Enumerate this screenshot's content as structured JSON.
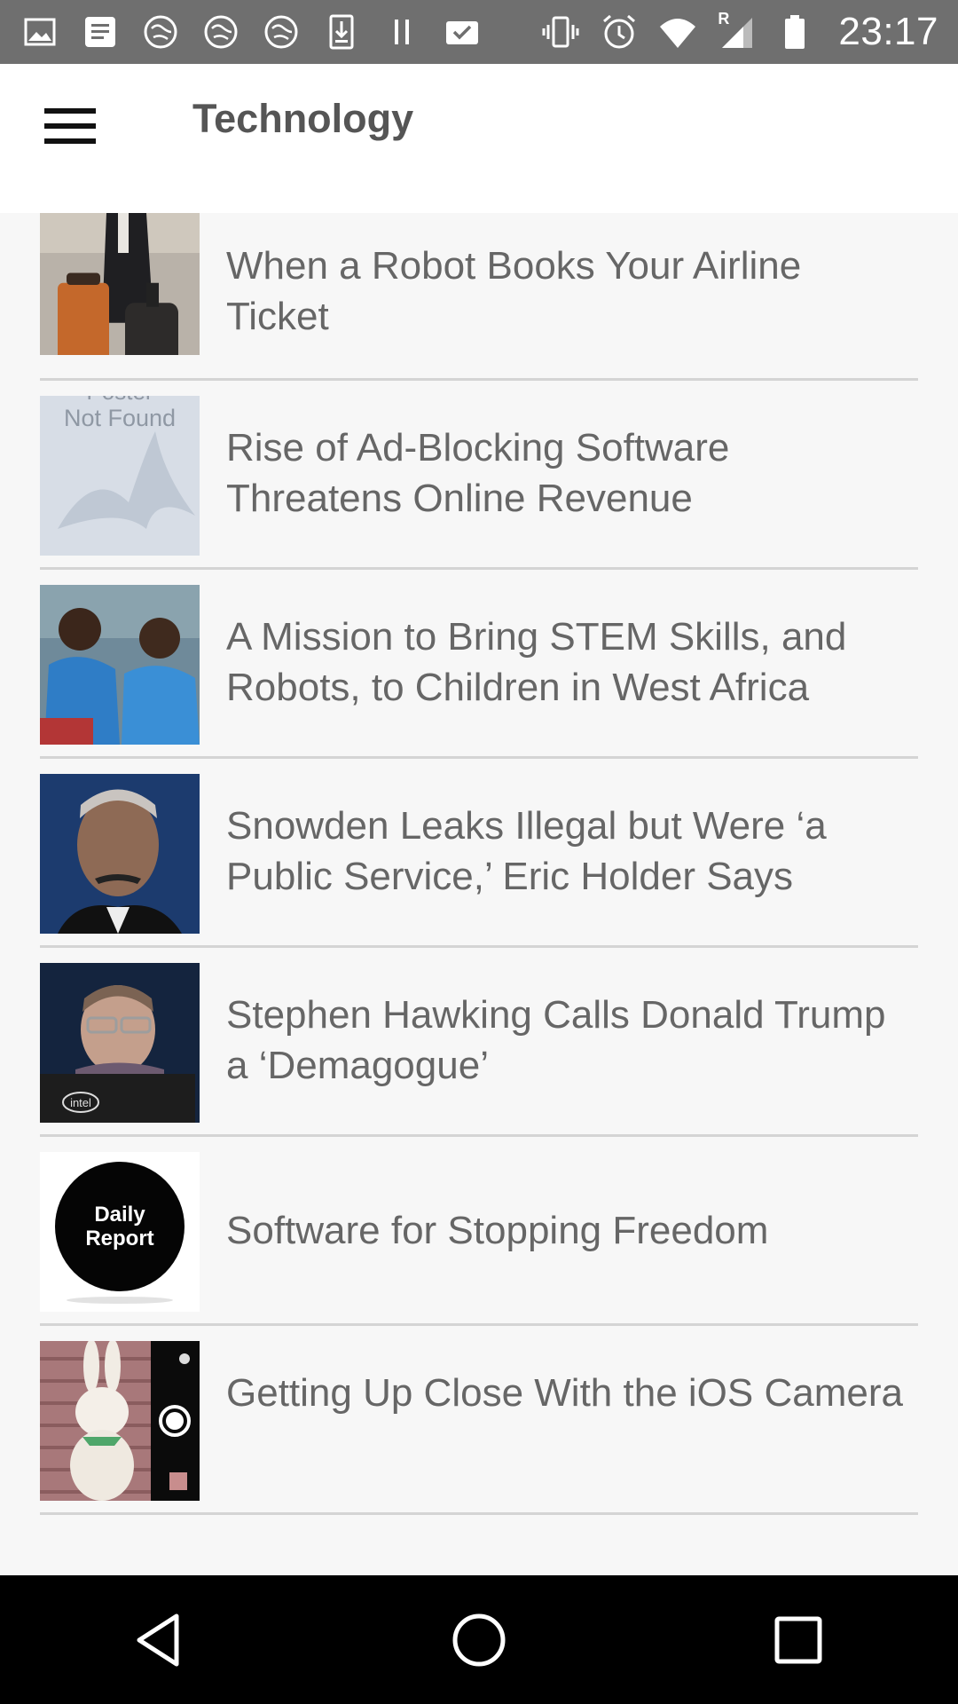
{
  "status_bar": {
    "time": "23:17",
    "left_icons": [
      "image-icon",
      "document-icon",
      "vpn-globe-icon",
      "vpn-globe-icon",
      "vpn-globe-icon",
      "download-icon",
      "pause-icon",
      "clipboard-check-icon"
    ],
    "right_icons": [
      "vibrate-icon",
      "alarm-icon",
      "wifi-icon",
      "signal-roaming-icon",
      "battery-icon"
    ],
    "roaming_label": "R"
  },
  "app_bar": {
    "title": "Technology",
    "menu_icon": "hamburger-menu-icon"
  },
  "articles": [
    {
      "headline": "When a Robot Books Your Airline Ticket",
      "thumb": "traveler-luggage"
    },
    {
      "headline": "Rise of Ad-Blocking Software Threatens Online Revenue",
      "thumb": "poster-not-found",
      "thumb_text_top": "Poster",
      "thumb_text": "Not Found"
    },
    {
      "headline": "A Mission to Bring STEM Skills, and Robots, to Children in West Africa",
      "thumb": "two-boys"
    },
    {
      "headline": "Snowden Leaks Illegal but Were ‘a Public Service,’ Eric Holder Says",
      "thumb": "portrait-man"
    },
    {
      "headline": "Stephen Hawking Calls Donald Trump a ‘Demagogue’",
      "thumb": "hawking",
      "thumb_text": "intel"
    },
    {
      "headline": "Software for Stopping Freedom",
      "thumb": "daily-report-logo",
      "thumb_text_1": "Daily",
      "thumb_text_2": "Report"
    },
    {
      "headline": "Getting Up Close With the iOS Camera",
      "thumb": "bunny-camera"
    }
  ],
  "nav_bar": {
    "back": "back-triangle-icon",
    "home": "home-circle-icon",
    "recents": "recents-square-icon"
  },
  "colors": {
    "status_bar": "#6f6f6f",
    "app_bar": "#ffffff",
    "list_background": "#f7f7f7",
    "headline": "#666666",
    "divider": "#d4d4d4",
    "nav_bar": "#000000"
  }
}
